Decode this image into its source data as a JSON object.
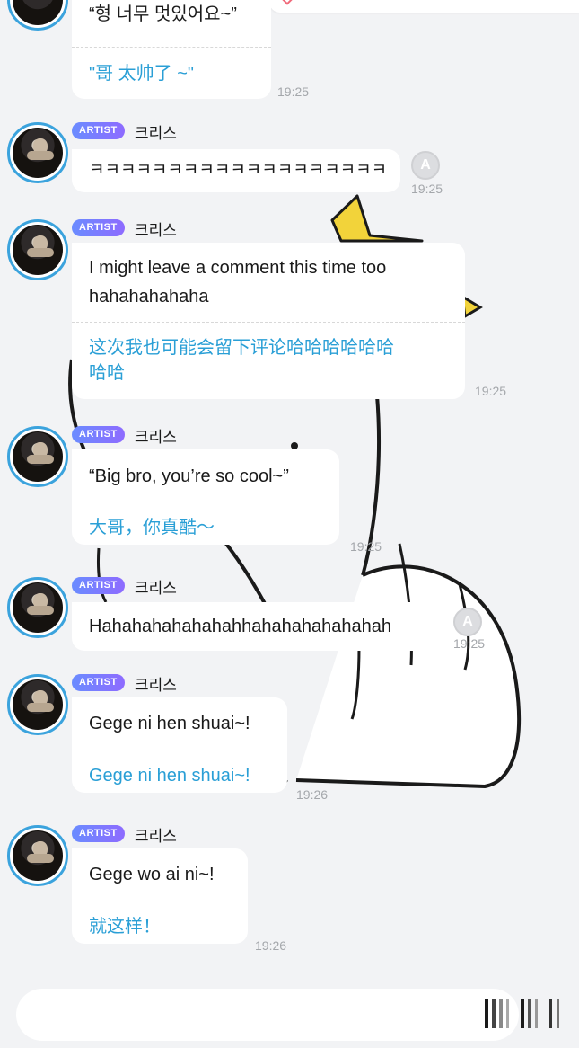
{
  "messages": [
    {
      "original": "“형 너무 멋있어요~”",
      "translation": "\"哥 太帅了 ~\"",
      "time": "19:25"
    },
    {
      "badge": "ARTIST",
      "sender": "크리스",
      "original": "ㅋㅋㅋㅋㅋㅋㅋㅋㅋㅋㅋㅋㅋㅋㅋㅋㅋㅋㅋ",
      "time": "19:25",
      "translate_icon": "A"
    },
    {
      "badge": "ARTIST",
      "sender": "크리스",
      "original_line1": "I might leave a comment this time too",
      "original_line2": "hahahahahaha",
      "translation_line1": "这次我也可能会留下评论哈哈哈哈哈哈",
      "translation_line2": "哈哈",
      "time": "19:25"
    },
    {
      "badge": "ARTIST",
      "sender": "크리스",
      "original": "“Big bro, you’re so cool~”",
      "translation": "大哥，你真酷～",
      "time": "19:25"
    },
    {
      "badge": "ARTIST",
      "sender": "크리스",
      "original": "Hahahahahahahahhahahahahahahah",
      "time": "19:25",
      "translate_icon": "A"
    },
    {
      "badge": "ARTIST",
      "sender": "크리스",
      "original": "Gege ni hen shuai~!",
      "translation": "Gege ni hen shuai~!",
      "time": "19:26"
    },
    {
      "badge": "ARTIST",
      "sender": "크리스",
      "original": "Gege wo ai ni~!",
      "translation": "就这样！",
      "time": "19:26"
    }
  ],
  "input": {
    "placeholder": ""
  },
  "colors": {
    "background": "#f2f3f5",
    "translation_text": "#2a9fd6",
    "avatar_ring": "#3ba3dd",
    "badge_gradient_start": "#6a8cff",
    "badge_gradient_end": "#8e6bff",
    "timestamp": "#a4a7ab",
    "sticker_accent": "#f2d33a"
  },
  "icons": {
    "translate": "translate-a-icon",
    "send": "send-bars-icon",
    "sticker": "cartoon-hand-sticker"
  }
}
